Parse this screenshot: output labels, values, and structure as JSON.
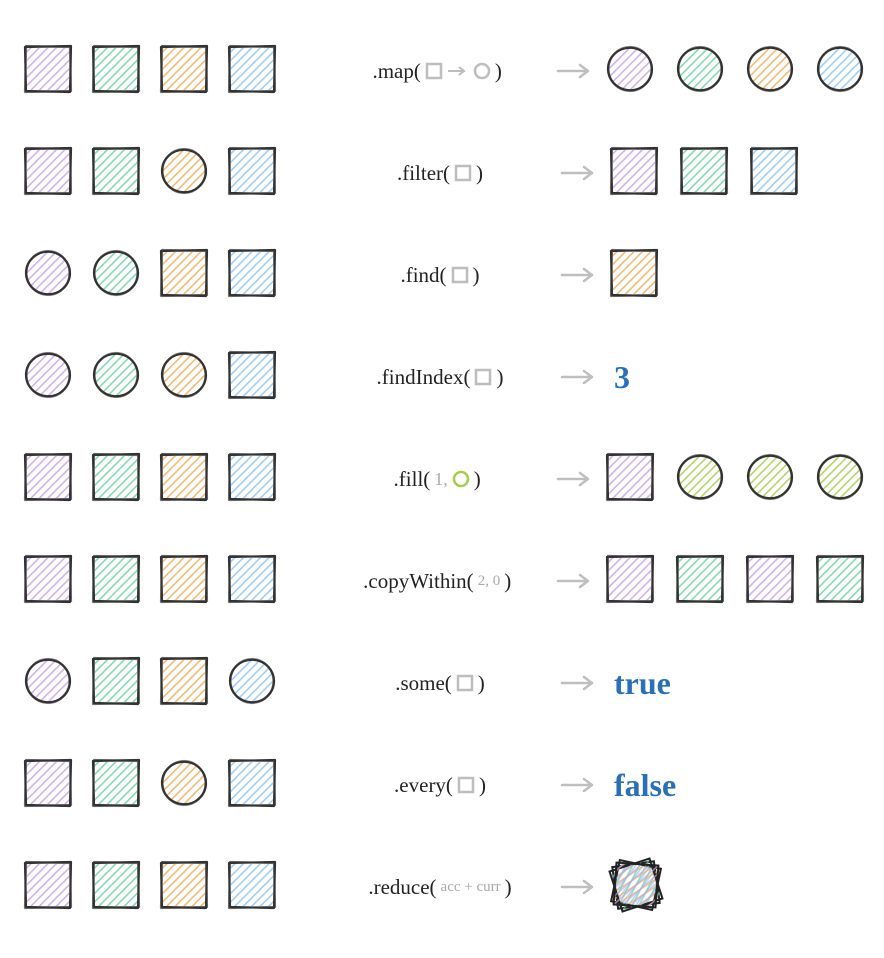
{
  "colors": {
    "purple": "#c9a3e6",
    "green": "#6fd1a8",
    "orange": "#f0ae5b",
    "blue": "#8ec5f5",
    "olive": "#a6cc4b",
    "gray": "#bdbdbd",
    "arrow": "#bfbfbf",
    "text_blue": "#2970b8"
  },
  "rows": [
    {
      "input": [
        {
          "shape": "square",
          "color": "purple"
        },
        {
          "shape": "square",
          "color": "green"
        },
        {
          "shape": "square",
          "color": "orange"
        },
        {
          "shape": "square",
          "color": "blue"
        }
      ],
      "method": {
        "name": ".map",
        "args_type": "map_transform"
      },
      "output": {
        "type": "shapes",
        "shapes": [
          {
            "shape": "circle",
            "color": "purple"
          },
          {
            "shape": "circle",
            "color": "green"
          },
          {
            "shape": "circle",
            "color": "orange"
          },
          {
            "shape": "circle",
            "color": "blue"
          }
        ]
      }
    },
    {
      "input": [
        {
          "shape": "square",
          "color": "purple"
        },
        {
          "shape": "square",
          "color": "green"
        },
        {
          "shape": "circle",
          "color": "orange"
        },
        {
          "shape": "square",
          "color": "blue"
        }
      ],
      "method": {
        "name": ".filter",
        "args_type": "square_glyph"
      },
      "output": {
        "type": "shapes",
        "shapes": [
          {
            "shape": "square",
            "color": "purple"
          },
          {
            "shape": "square",
            "color": "green"
          },
          {
            "shape": "square",
            "color": "blue"
          }
        ]
      }
    },
    {
      "input": [
        {
          "shape": "circle",
          "color": "purple"
        },
        {
          "shape": "circle",
          "color": "green"
        },
        {
          "shape": "square",
          "color": "orange"
        },
        {
          "shape": "square",
          "color": "blue"
        }
      ],
      "method": {
        "name": ".find",
        "args_type": "square_glyph"
      },
      "output": {
        "type": "shapes",
        "shapes": [
          {
            "shape": "square",
            "color": "orange"
          }
        ]
      }
    },
    {
      "input": [
        {
          "shape": "circle",
          "color": "purple"
        },
        {
          "shape": "circle",
          "color": "green"
        },
        {
          "shape": "circle",
          "color": "orange"
        },
        {
          "shape": "square",
          "color": "blue"
        }
      ],
      "method": {
        "name": ".findIndex",
        "args_type": "square_glyph"
      },
      "output": {
        "type": "text",
        "value": "3"
      }
    },
    {
      "input": [
        {
          "shape": "square",
          "color": "purple"
        },
        {
          "shape": "square",
          "color": "green"
        },
        {
          "shape": "square",
          "color": "orange"
        },
        {
          "shape": "square",
          "color": "blue"
        }
      ],
      "method": {
        "name": ".fill",
        "args_type": "fill_args",
        "arg1": "1"
      },
      "output": {
        "type": "shapes",
        "shapes": [
          {
            "shape": "square",
            "color": "purple"
          },
          {
            "shape": "circle",
            "color": "olive"
          },
          {
            "shape": "circle",
            "color": "olive"
          },
          {
            "shape": "circle",
            "color": "olive"
          }
        ]
      }
    },
    {
      "input": [
        {
          "shape": "square",
          "color": "purple"
        },
        {
          "shape": "square",
          "color": "green"
        },
        {
          "shape": "square",
          "color": "orange"
        },
        {
          "shape": "square",
          "color": "blue"
        }
      ],
      "method": {
        "name": ".copyWithin",
        "args_type": "text_args",
        "text": "2, 0"
      },
      "output": {
        "type": "shapes",
        "shapes": [
          {
            "shape": "square",
            "color": "purple"
          },
          {
            "shape": "square",
            "color": "green"
          },
          {
            "shape": "square",
            "color": "purple"
          },
          {
            "shape": "square",
            "color": "green"
          }
        ]
      }
    },
    {
      "input": [
        {
          "shape": "circle",
          "color": "purple"
        },
        {
          "shape": "square",
          "color": "green"
        },
        {
          "shape": "square",
          "color": "orange"
        },
        {
          "shape": "circle",
          "color": "blue"
        }
      ],
      "method": {
        "name": ".some",
        "args_type": "square_glyph"
      },
      "output": {
        "type": "text",
        "value": "true"
      }
    },
    {
      "input": [
        {
          "shape": "square",
          "color": "purple"
        },
        {
          "shape": "square",
          "color": "green"
        },
        {
          "shape": "circle",
          "color": "orange"
        },
        {
          "shape": "square",
          "color": "blue"
        }
      ],
      "method": {
        "name": ".every",
        "args_type": "square_glyph"
      },
      "output": {
        "type": "text",
        "value": "false"
      }
    },
    {
      "input": [
        {
          "shape": "square",
          "color": "purple"
        },
        {
          "shape": "square",
          "color": "green"
        },
        {
          "shape": "square",
          "color": "orange"
        },
        {
          "shape": "square",
          "color": "blue"
        }
      ],
      "method": {
        "name": ".reduce",
        "args_type": "text_args",
        "text": "acc + curr"
      },
      "output": {
        "type": "stack"
      }
    }
  ]
}
